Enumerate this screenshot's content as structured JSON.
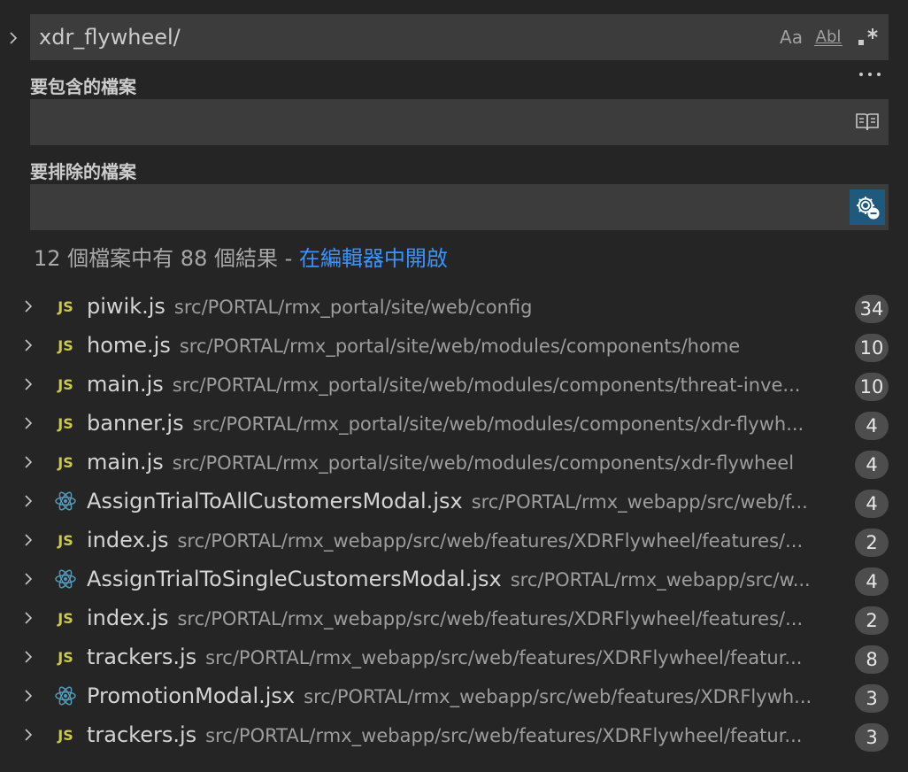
{
  "search": {
    "query": "xdr_flywheel/",
    "match_case_label": "Aa",
    "whole_word_label": "Abl",
    "regex_label": ".*"
  },
  "include": {
    "label": "要包含的檔案",
    "value": ""
  },
  "exclude": {
    "label": "要排除的檔案",
    "value": ""
  },
  "summary": {
    "text": "12 個檔案中有 88 個結果 - ",
    "link": "在編輯器中開啟"
  },
  "results": [
    {
      "icon": "js-file-icon",
      "name": "piwik.js",
      "path": "src/PORTAL/rmx_portal/site/web/config",
      "count": "34"
    },
    {
      "icon": "js-file-icon",
      "name": "home.js",
      "path": "src/PORTAL/rmx_portal/site/web/modules/components/home",
      "count": "10"
    },
    {
      "icon": "js-file-icon",
      "name": "main.js",
      "path": "src/PORTAL/rmx_portal/site/web/modules/components/threat-inve...",
      "count": "10"
    },
    {
      "icon": "js-file-icon",
      "name": "banner.js",
      "path": "src/PORTAL/rmx_portal/site/web/modules/components/xdr-flywh...",
      "count": "4"
    },
    {
      "icon": "js-file-icon",
      "name": "main.js",
      "path": "src/PORTAL/rmx_portal/site/web/modules/components/xdr-flywheel",
      "count": "4"
    },
    {
      "icon": "react-file-icon",
      "name": "AssignTrialToAllCustomersModal.jsx",
      "path": "src/PORTAL/rmx_webapp/src/web/f...",
      "count": "4"
    },
    {
      "icon": "js-file-icon",
      "name": "index.js",
      "path": "src/PORTAL/rmx_webapp/src/web/features/XDRFlywheel/features/...",
      "count": "2"
    },
    {
      "icon": "react-file-icon",
      "name": "AssignTrialToSingleCustomersModal.jsx",
      "path": "src/PORTAL/rmx_webapp/src/w...",
      "count": "4"
    },
    {
      "icon": "js-file-icon",
      "name": "index.js",
      "path": "src/PORTAL/rmx_webapp/src/web/features/XDRFlywheel/features/...",
      "count": "2"
    },
    {
      "icon": "js-file-icon",
      "name": "trackers.js",
      "path": "src/PORTAL/rmx_webapp/src/web/features/XDRFlywheel/featur...",
      "count": "8"
    },
    {
      "icon": "react-file-icon",
      "name": "PromotionModal.jsx",
      "path": "src/PORTAL/rmx_webapp/src/web/features/XDRFlywh...",
      "count": "3"
    },
    {
      "icon": "js-file-icon",
      "name": "trackers.js",
      "path": "src/PORTAL/rmx_webapp/src/web/features/XDRFlywheel/featur...",
      "count": "3"
    }
  ],
  "colors": {
    "background": "#252526",
    "input_background": "#3c3c3c",
    "link": "#3794ff",
    "js_icon": "#cbcb41",
    "react_icon": "#519aba",
    "badge": "#4d4d4d",
    "active_toggle": "#1e5a7d"
  }
}
